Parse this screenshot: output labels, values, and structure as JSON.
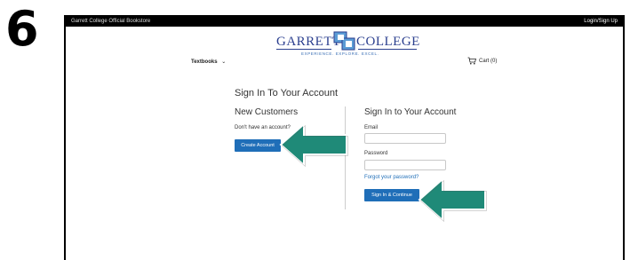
{
  "step_number": "6",
  "topbar": {
    "store_name": "Garrett College Official Bookstore",
    "login_link": "Login/Sign Up"
  },
  "logo": {
    "word_left": "GARRETT",
    "word_right": "COLLEGE",
    "tagline": "EXPERIENCE. EXPLORE. EXCEL."
  },
  "nav": {
    "textbooks": "Textbooks",
    "cart": "Cart (0)"
  },
  "page_title": "Sign In To Your Account",
  "new_customers": {
    "heading": "New Customers",
    "prompt": "Don't have an account?",
    "create_button": "Create Account"
  },
  "sign_in": {
    "heading": "Sign In to Your Account",
    "email_label": "Email",
    "email_value": "",
    "password_label": "Password",
    "password_value": "",
    "forgot_link": "Forgot your password?",
    "submit_button": "Sign In & Continue"
  },
  "colors": {
    "brand_blue": "#2b3f8f",
    "button_blue": "#1f6eb8",
    "arrow_teal": "#1f8a78"
  }
}
